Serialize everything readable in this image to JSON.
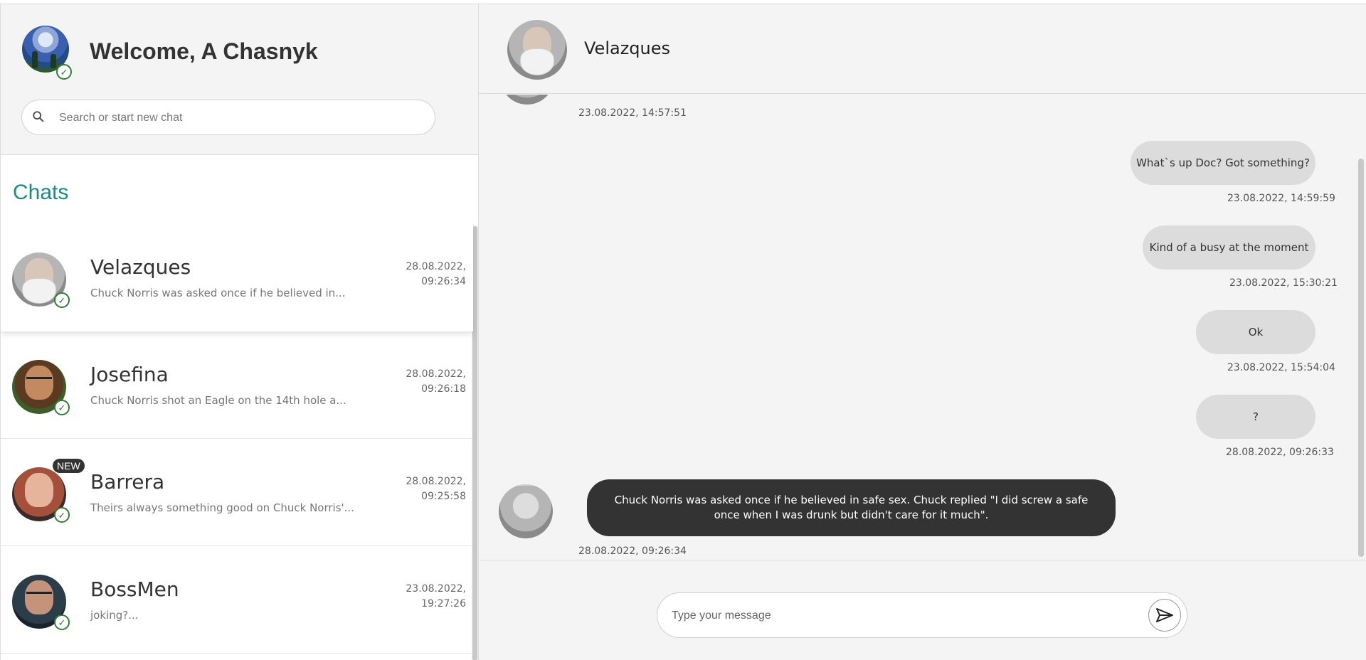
{
  "user": {
    "welcome": "Welcome, A Chasnyk"
  },
  "search": {
    "placeholder": "Search or start new chat"
  },
  "sidebar": {
    "chats_title": "Chats",
    "chats": [
      {
        "name": "Velazques",
        "preview": "Chuck Norris was asked once if he believed in...",
        "date": "28.08.2022,",
        "time": "09:26:34",
        "online": true,
        "badge": ""
      },
      {
        "name": "Josefina",
        "preview": "Chuck Norris shot an Eagle on the 14th hole a...",
        "date": "28.08.2022,",
        "time": "09:26:18",
        "online": true,
        "badge": ""
      },
      {
        "name": "Barrera",
        "preview": "Theirs always something good on Chuck Norris'...",
        "date": "28.08.2022,",
        "time": "09:25:58",
        "online": true,
        "badge": "NEW"
      },
      {
        "name": "BossMen",
        "preview": "joking?...",
        "date": "23.08.2022,",
        "time": "19:27:26",
        "online": true,
        "badge": ""
      }
    ]
  },
  "conversation": {
    "contact_name": "Velazques",
    "messages": [
      {
        "direction": "in",
        "text": "",
        "timestamp": "23.08.2022, 14:57:51"
      },
      {
        "direction": "out",
        "text": "What`s up Doc? Got something?",
        "timestamp": "23.08.2022, 14:59:59"
      },
      {
        "direction": "out",
        "text": "Kind of a busy at the moment",
        "timestamp": "23.08.2022, 15:30:21"
      },
      {
        "direction": "out",
        "text": "Ok",
        "timestamp": "23.08.2022, 15:54:04"
      },
      {
        "direction": "out",
        "text": "?",
        "timestamp": "28.08.2022, 09:26:33"
      },
      {
        "direction": "in",
        "text": "Chuck Norris was asked once if he believed in safe sex. Chuck replied \"I did screw a safe once when I was drunk but didn't care for it much\".",
        "timestamp": "28.08.2022, 09:26:34"
      }
    ]
  },
  "composer": {
    "placeholder": "Type your message"
  },
  "colors": {
    "accent": "#1b8a8a",
    "online": "#2e7d32",
    "incoming_bubble": "#333333",
    "outgoing_bubble": "#dcdcdc"
  }
}
